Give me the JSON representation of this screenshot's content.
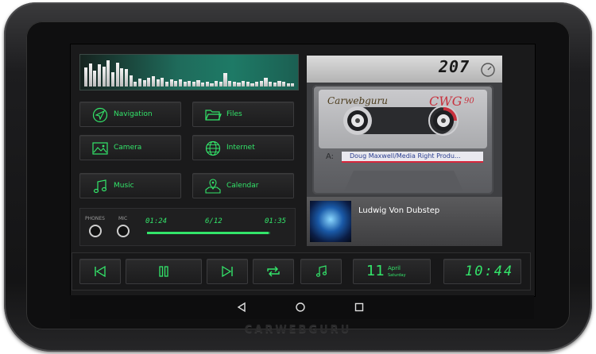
{
  "brand": "CARWEBGURU",
  "equalizer": {
    "bars": [
      0.68,
      0.8,
      0.55,
      0.78,
      0.7,
      0.92,
      0.5,
      0.82,
      0.65,
      0.6,
      0.4,
      0.18,
      0.28,
      0.22,
      0.3,
      0.36,
      0.24,
      0.3,
      0.18,
      0.24,
      0.2,
      0.26,
      0.16,
      0.2,
      0.18,
      0.22,
      0.14,
      0.18,
      0.12,
      0.2,
      0.16,
      0.48,
      0.2,
      0.18,
      0.14,
      0.2,
      0.16,
      0.12,
      0.18,
      0.2,
      0.3,
      0.16,
      0.14,
      0.2,
      0.18,
      0.12,
      0.1
    ]
  },
  "apps": [
    {
      "label": "Navigation",
      "icon": "navigation-arrow-icon"
    },
    {
      "label": "Files",
      "icon": "folder-icon"
    },
    {
      "label": "Camera",
      "icon": "image-icon"
    },
    {
      "label": "Internet",
      "icon": "globe-icon"
    },
    {
      "label": "Music",
      "icon": "music-note-icon"
    },
    {
      "label": "Calendar",
      "icon": "map-calendar-icon"
    }
  ],
  "audio": {
    "phones_label": "PHONES",
    "mic_label": "MIC"
  },
  "player": {
    "elapsed": "01:24",
    "track_position": "6/12",
    "remaining": "01:35",
    "progress": 0.99
  },
  "speed": "207",
  "cassette": {
    "brand_left": "Carwebguru",
    "brand_right": "CWG",
    "brand_number": "90",
    "side": "A:",
    "label": "Doug Maxwell/Media Right Produ..."
  },
  "now_playing": {
    "title": "Ludwig Von Dubstep"
  },
  "date": {
    "day": "11",
    "month": "April",
    "weekday": "Saturday"
  },
  "clock": "10:44",
  "colors": {
    "accent": "#33e56a",
    "panel": "#1c1c1d",
    "bezel": "#141415"
  }
}
